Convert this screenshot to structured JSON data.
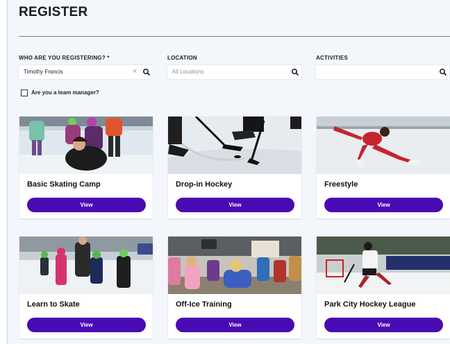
{
  "page": {
    "title": "REGISTER"
  },
  "filters": {
    "who_label": "WHO ARE YOU REGISTERING? *",
    "who_value": "Timothy Francis",
    "location_label": "LOCATION",
    "location_placeholder": "All Locations",
    "activities_label": "ACTIVITIES",
    "activities_value": "",
    "team_manager_label": "Are you a team manager?"
  },
  "cards": [
    {
      "name": "Basic Skating Camp",
      "button": "View",
      "image": "kids-skating-photo"
    },
    {
      "name": "Drop-in Hockey",
      "button": "View",
      "image": "hockey-sticks-photo"
    },
    {
      "name": "Freestyle",
      "button": "View",
      "image": "figure-skater-photo"
    },
    {
      "name": "Learn to Skate",
      "button": "View",
      "image": "learn-to-skate-photo"
    },
    {
      "name": "Off-Ice Training",
      "button": "View",
      "image": "off-ice-training-photo"
    },
    {
      "name": "Park City Hockey League",
      "button": "View",
      "image": "hockey-player-photo"
    }
  ],
  "colors": {
    "accent": "#4a0ab3",
    "background": "#f3f6fb"
  }
}
